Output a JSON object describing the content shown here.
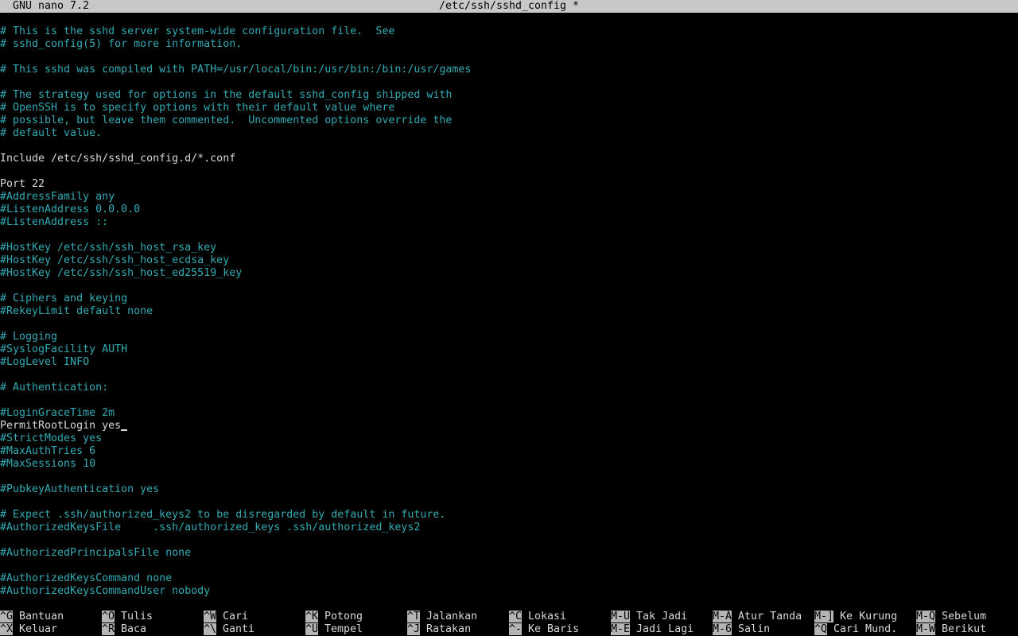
{
  "title": {
    "app": "GNU nano 7.2",
    "file": "/etc/ssh/sshd_config *"
  },
  "colors": {
    "comment": "#33aab3",
    "text": "#d8d8d8",
    "bar": "#c8c8c8"
  },
  "lines": [
    "# This is the sshd server system-wide configuration file.  See",
    "# sshd_config(5) for more information.",
    "",
    "# This sshd was compiled with PATH=/usr/local/bin:/usr/bin:/bin:/usr/games",
    "",
    "# The strategy used for options in the default sshd_config shipped with",
    "# OpenSSH is to specify options with their default value where",
    "# possible, but leave them commented.  Uncommented options override the",
    "# default value.",
    "",
    "Include /etc/ssh/sshd_config.d/*.conf",
    "",
    "Port 22",
    "#AddressFamily any",
    "#ListenAddress 0.0.0.0",
    "#ListenAddress ::",
    "",
    "#HostKey /etc/ssh/ssh_host_rsa_key",
    "#HostKey /etc/ssh/ssh_host_ecdsa_key",
    "#HostKey /etc/ssh/ssh_host_ed25519_key",
    "",
    "# Ciphers and keying",
    "#RekeyLimit default none",
    "",
    "# Logging",
    "#SyslogFacility AUTH",
    "#LogLevel INFO",
    "",
    "# Authentication:",
    "",
    "#LoginGraceTime 2m",
    "PermitRootLogin yes",
    "#StrictModes yes",
    "#MaxAuthTries 6",
    "#MaxSessions 10",
    "",
    "#PubkeyAuthentication yes",
    "",
    "# Expect .ssh/authorized_keys2 to be disregarded by default in future.",
    "#AuthorizedKeysFile     .ssh/authorized_keys .ssh/authorized_keys2",
    "",
    "#AuthorizedPrincipalsFile none",
    "",
    "#AuthorizedKeysCommand none",
    "#AuthorizedKeysCommandUser nobody"
  ],
  "cursor_line": 31,
  "shortcuts": [
    [
      {
        "key": "^G",
        "label": "Bantuan"
      },
      {
        "key": "^O",
        "label": "Tulis"
      },
      {
        "key": "^W",
        "label": "Cari"
      },
      {
        "key": "^K",
        "label": "Potong"
      },
      {
        "key": "^T",
        "label": "Jalankan"
      },
      {
        "key": "^C",
        "label": "Lokasi"
      },
      {
        "key": "M-U",
        "label": "Tak Jadi"
      },
      {
        "key": "M-A",
        "label": "Atur Tanda"
      },
      {
        "key": "M-]",
        "label": "Ke Kurung"
      },
      {
        "key": "M-Q",
        "label": "Sebelum"
      }
    ],
    [
      {
        "key": "^X",
        "label": "Keluar"
      },
      {
        "key": "^R",
        "label": "Baca"
      },
      {
        "key": "^\\",
        "label": "Ganti"
      },
      {
        "key": "^U",
        "label": "Tempel"
      },
      {
        "key": "^J",
        "label": "Ratakan"
      },
      {
        "key": "^-",
        "label": "Ke Baris"
      },
      {
        "key": "M-E",
        "label": "Jadi Lagi"
      },
      {
        "key": "M-6",
        "label": "Salin"
      },
      {
        "key": "^Q",
        "label": "Cari Mund."
      },
      {
        "key": "M-W",
        "label": "Berikut"
      }
    ]
  ]
}
